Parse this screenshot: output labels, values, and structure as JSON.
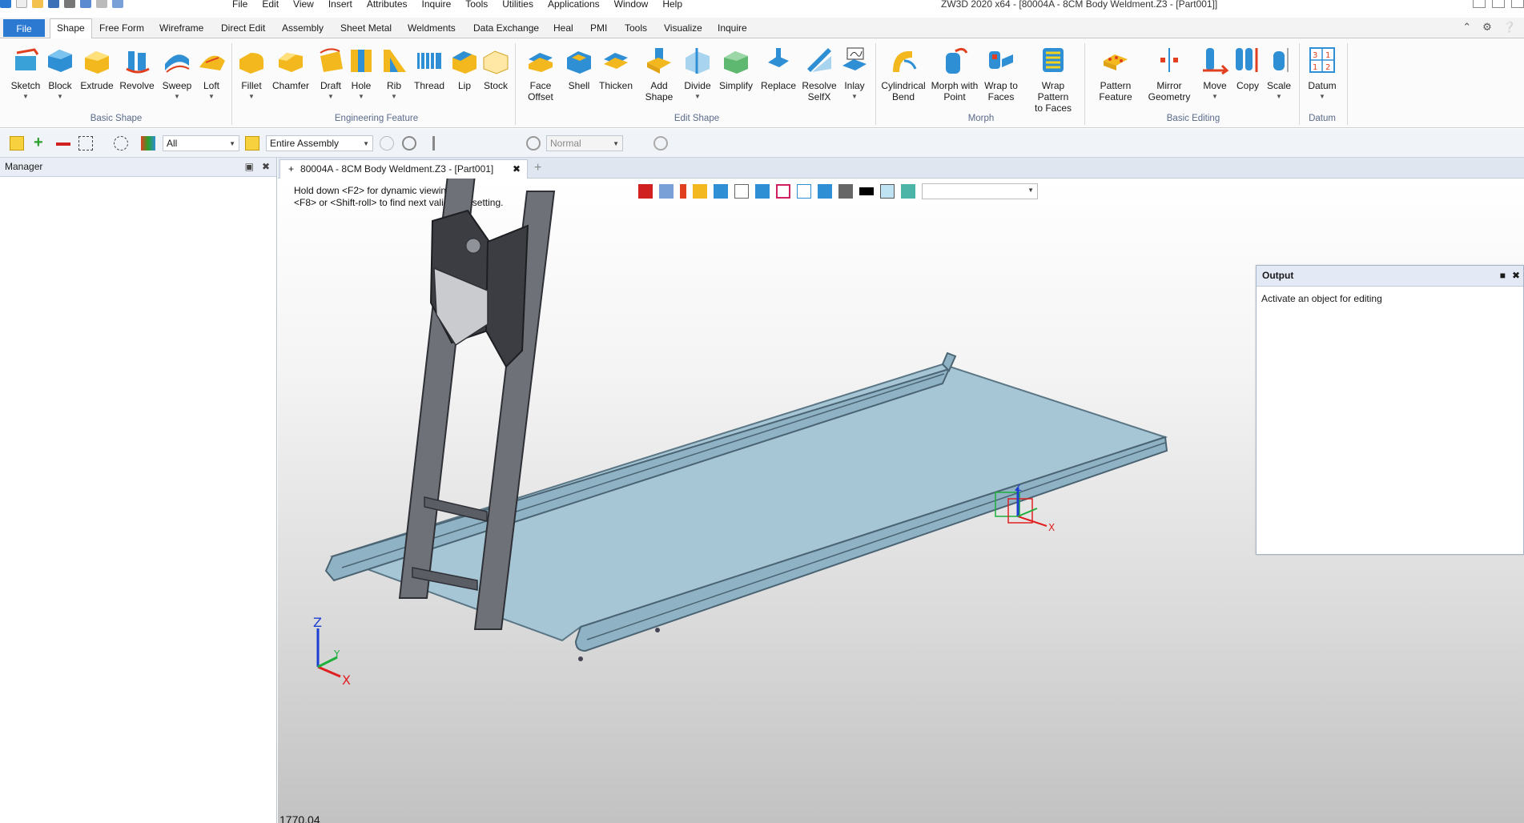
{
  "app": {
    "title": "ZW3D 2020 x64 - [80004A - 8CM Body Weldment.Z3 - [Part001]]",
    "menu": [
      "File",
      "Edit",
      "View",
      "Insert",
      "Attributes",
      "Inquire",
      "Tools",
      "Utilities",
      "Applications",
      "Window",
      "Help"
    ]
  },
  "ribbon_tabs": [
    "File",
    "Shape",
    "Free Form",
    "Wireframe",
    "Direct Edit",
    "Assembly",
    "Sheet Metal",
    "Weldments",
    "Data Exchange",
    "Heal",
    "PMI",
    "Tools",
    "Visualize",
    "Inquire"
  ],
  "active_tab": "Shape",
  "groups": {
    "basic_shape": {
      "label": "Basic Shape",
      "buttons": [
        {
          "label": "Sketch",
          "icon": "sketch-icon"
        },
        {
          "label": "Block",
          "icon": "block-icon"
        },
        {
          "label": "Extrude",
          "icon": "extrude-icon"
        },
        {
          "label": "Revolve",
          "icon": "revolve-icon"
        },
        {
          "label": "Sweep",
          "icon": "sweep-icon"
        },
        {
          "label": "Loft",
          "icon": "loft-icon"
        }
      ]
    },
    "engineering_feature": {
      "label": "Engineering Feature",
      "buttons": [
        {
          "label": "Fillet",
          "icon": "fillet-icon"
        },
        {
          "label": "Chamfer",
          "icon": "chamfer-icon"
        },
        {
          "label": "Draft",
          "icon": "draft-icon"
        },
        {
          "label": "Hole",
          "icon": "hole-icon"
        },
        {
          "label": "Rib",
          "icon": "rib-icon"
        },
        {
          "label": "Thread",
          "icon": "thread-icon"
        },
        {
          "label": "Lip",
          "icon": "lip-icon"
        },
        {
          "label": "Stock",
          "icon": "stock-icon"
        }
      ]
    },
    "edit_shape": {
      "label": "Edit Shape",
      "buttons": [
        {
          "label": "Face",
          "label2": "Offset",
          "icon": "face-offset-icon"
        },
        {
          "label": "Shell",
          "icon": "shell-icon"
        },
        {
          "label": "Thicken",
          "icon": "thicken-icon"
        },
        {
          "label": "Add",
          "label2": "Shape",
          "icon": "add-shape-icon"
        },
        {
          "label": "Divide",
          "icon": "divide-icon"
        },
        {
          "label": "Simplify",
          "icon": "simplify-icon"
        },
        {
          "label": "Replace",
          "icon": "replace-icon"
        },
        {
          "label": "Resolve",
          "label2": "SelfX",
          "icon": "resolve-selfx-icon"
        },
        {
          "label": "Inlay",
          "icon": "inlay-icon"
        }
      ]
    },
    "morph": {
      "label": "Morph",
      "buttons": [
        {
          "label": "Cylindrical",
          "label2": "Bend",
          "icon": "cylindrical-bend-icon"
        },
        {
          "label": "Morph with",
          "label2": "Point",
          "icon": "morph-point-icon"
        },
        {
          "label": "Wrap to",
          "label2": "Faces",
          "icon": "wrap-faces-icon"
        },
        {
          "label": "Wrap Pattern",
          "label2": "to Faces",
          "icon": "wrap-pattern-icon"
        }
      ]
    },
    "basic_editing": {
      "label": "Basic Editing",
      "buttons": [
        {
          "label": "Pattern",
          "label2": "Feature",
          "icon": "pattern-feature-icon"
        },
        {
          "label": "Mirror",
          "label2": "Geometry",
          "icon": "mirror-geometry-icon"
        },
        {
          "label": "Move",
          "icon": "move-icon"
        },
        {
          "label": "Copy",
          "icon": "copy-icon"
        },
        {
          "label": "Scale",
          "icon": "scale-icon"
        }
      ]
    },
    "datum": {
      "label": "Datum",
      "buttons": [
        {
          "label": "Datum",
          "icon": "datum-icon"
        }
      ]
    }
  },
  "toolbar": {
    "filter_value": "All",
    "scope_value": "Entire Assembly",
    "mode_value": "Normal"
  },
  "manager": {
    "title": "Manager"
  },
  "document": {
    "tab_label": "80004A - 8CM Body Weldment.Z3 - [Part001]",
    "hint_line1": "Hold down <F2> for dynamic viewing.",
    "hint_line2": "<F8> or <Shift-roll> to find next valid filter setting.",
    "coord_readout": "1770.04"
  },
  "output": {
    "title": "Output",
    "message": "Activate an object for editing"
  },
  "colors": {
    "accent": "#2b79d0",
    "model_body": "#a6c6d6",
    "tube": "#6e7178",
    "plate": "#3b3d42",
    "axis_x": "#e02020",
    "axis_y": "#1fae3a",
    "axis_z": "#1c3fd1"
  }
}
